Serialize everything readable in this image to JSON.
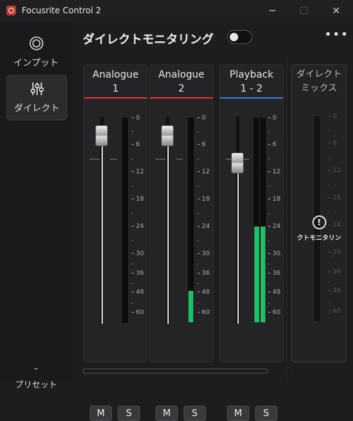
{
  "window": {
    "title": "Focusrite Control 2",
    "minimize_icon": "minimize-icon",
    "maximize_icon": "maximize-icon",
    "close_icon": "close-icon"
  },
  "sidebar": {
    "items": [
      {
        "label": "インプット",
        "icon": "input-ring-icon",
        "active": false
      },
      {
        "label": "ダイレクト",
        "icon": "mixer-sliders-icon",
        "active": true
      }
    ],
    "preset": {
      "value": "–",
      "label": "プリセット"
    }
  },
  "header": {
    "title": "ダイレクトモニタリング",
    "toggle_on": false,
    "more_icon": "more-horizontal-icon"
  },
  "channels": [
    {
      "name_line1": "Analogue",
      "name_line2": "1",
      "line_color": "#e0323c",
      "fader_db": -4,
      "meter_db": null,
      "mute": "M",
      "solo": "S"
    },
    {
      "name_line1": "Analogue",
      "name_line2": "2",
      "line_color": "#e0323c",
      "fader_db": -4,
      "meter_db": -47,
      "mute": "M",
      "solo": "S"
    },
    {
      "name_line1": "Playback",
      "name_line2": "1 - 2",
      "line_color": "#3a7bd5",
      "fader_db": -10,
      "meter_db": -24,
      "mute": "M",
      "solo": "S"
    }
  ],
  "scale_labels": [
    "0",
    "6",
    "12",
    "18",
    "24",
    "30",
    "36",
    "48",
    "60"
  ],
  "direct_mix": {
    "line1": "ダイレクト",
    "line2": "ミックス",
    "info_icon": "info-icon",
    "info_symbol": "!",
    "warning": "クトモニタリン"
  },
  "colors": {
    "meter_green": "#1fbf6a",
    "analogue_line": "#e0323c",
    "playback_line": "#3a7bd5"
  }
}
